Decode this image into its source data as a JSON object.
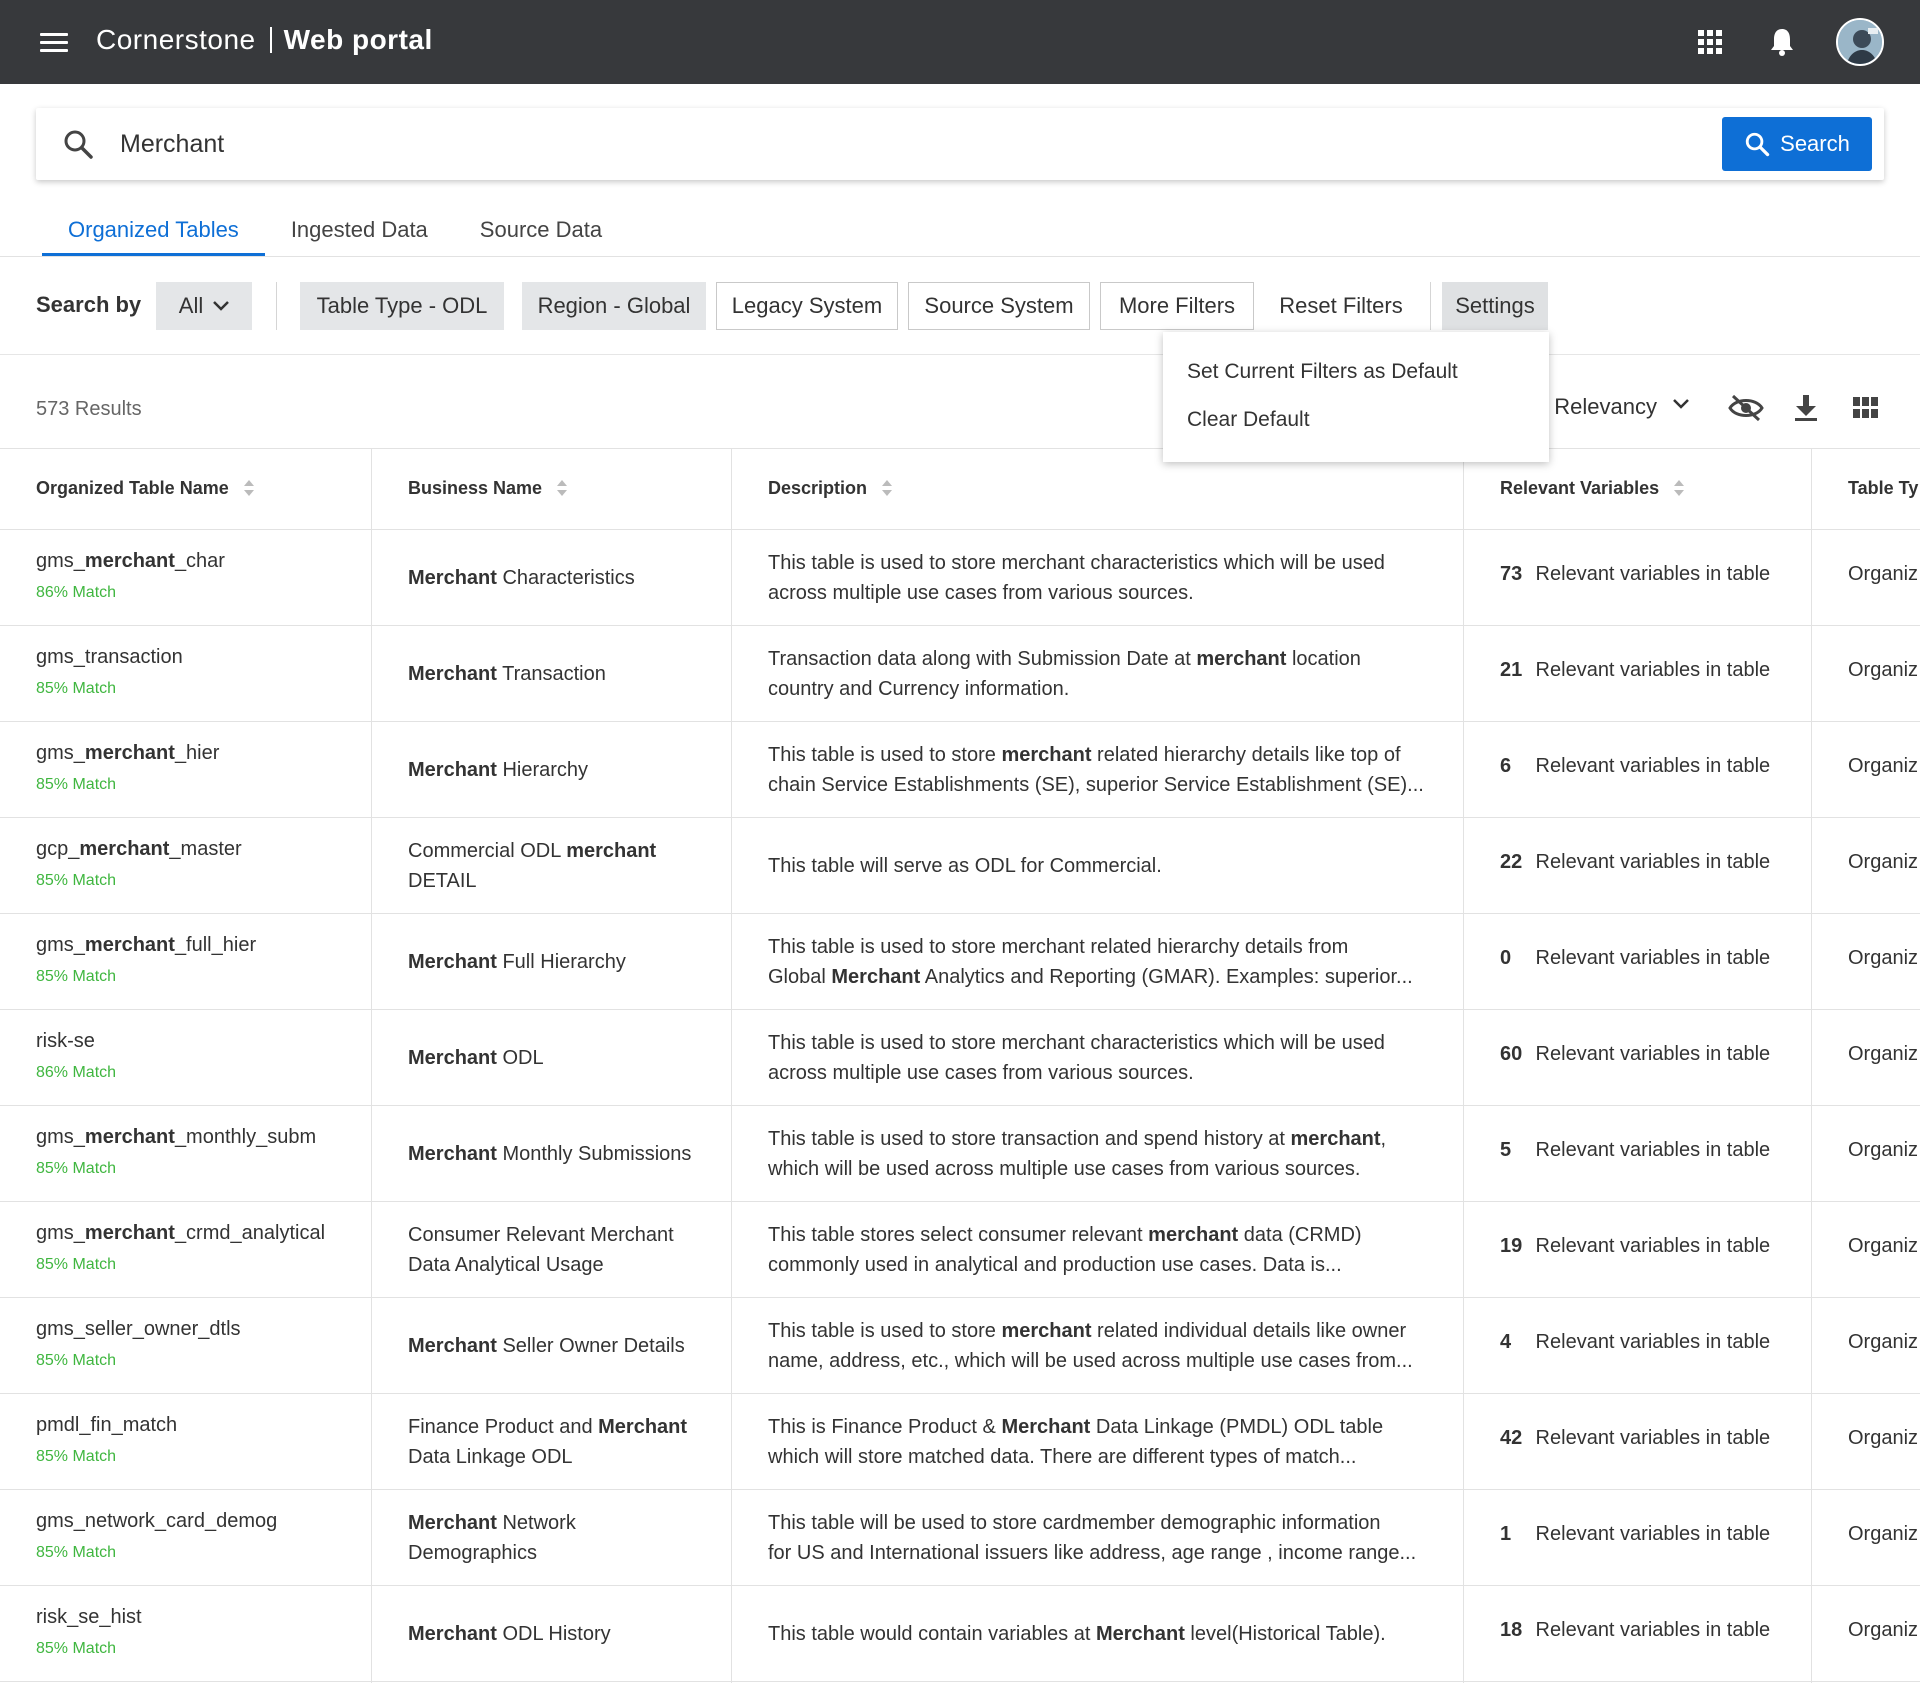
{
  "header": {
    "brand_light": "Cornerstone",
    "brand_bold": "Web portal"
  },
  "search": {
    "value": "Merchant",
    "placeholder": "",
    "button_label": "Search"
  },
  "tabs": [
    {
      "label": "Organized Tables",
      "active": true
    },
    {
      "label": "Ingested Data",
      "active": false
    },
    {
      "label": "Source Data",
      "active": false
    }
  ],
  "filters": {
    "search_by_label": "Search by",
    "all_label": "All",
    "chips": [
      "Table Type - ODL",
      "Region - Global",
      "Legacy System",
      "Source System",
      "More Filters",
      "Reset Filters",
      "Settings"
    ]
  },
  "settings_menu": {
    "items": [
      "Set Current Filters as Default",
      "Clear Default"
    ]
  },
  "results": {
    "count_label": "573 Results",
    "sort_label": ": Relevancy"
  },
  "columns": [
    "Organized Table Name",
    "Business Name",
    "Description",
    "Relevant Variables",
    "Table Ty"
  ],
  "rel_suffix": "Relevant variables in table",
  "rows": [
    {
      "name": [
        [
          "gms_",
          false
        ],
        [
          "merchant",
          true
        ],
        [
          "_char",
          false
        ]
      ],
      "match": "86% Match",
      "business": [
        [
          "Merchant",
          true
        ],
        [
          " Characteristics",
          false
        ]
      ],
      "business_lines": 1,
      "desc1": [
        [
          "This table is used to store merchant characteristics which will be used",
          false
        ]
      ],
      "desc2": [
        [
          "across multiple use cases from various sources.",
          false
        ]
      ],
      "rel": "73",
      "type": "Organiz"
    },
    {
      "name": [
        [
          "gms_transaction",
          false
        ]
      ],
      "match": "85% Match",
      "business": [
        [
          "Merchant",
          true
        ],
        [
          " Transaction",
          false
        ]
      ],
      "business_lines": 1,
      "desc1": [
        [
          "Transaction data along with Submission Date at ",
          false
        ],
        [
          "merchant",
          true
        ],
        [
          " location",
          false
        ]
      ],
      "desc2": [
        [
          "country and Currency information.",
          false
        ]
      ],
      "rel": "21",
      "type": "Organiz"
    },
    {
      "name": [
        [
          "gms_",
          false
        ],
        [
          "merchant",
          true
        ],
        [
          "_hier",
          false
        ]
      ],
      "match": "85% Match",
      "business": [
        [
          "Merchant",
          true
        ],
        [
          " Hierarchy",
          false
        ]
      ],
      "business_lines": 1,
      "desc1": [
        [
          "This table is used to store ",
          false
        ],
        [
          "merchant",
          true
        ],
        [
          " related hierarchy details like top of",
          false
        ]
      ],
      "desc2": [
        [
          "chain Service Establishments (SE), superior Service Establishment (SE)...",
          false
        ]
      ],
      "rel": "6",
      "type": "Organiz"
    },
    {
      "name": [
        [
          "gcp_",
          false
        ],
        [
          "merchant",
          true
        ],
        [
          "_master",
          false
        ]
      ],
      "match": "85% Match",
      "business": [
        [
          "Commercial ODL ",
          false
        ],
        [
          "merchant",
          true
        ]
      ],
      "business2": [
        [
          "DETAIL",
          false
        ]
      ],
      "business_lines": 2,
      "desc1": [
        [
          "This table will serve as ODL for Commercial.",
          false
        ]
      ],
      "desc2": [],
      "rel": "22",
      "type": "Organiz"
    },
    {
      "name": [
        [
          "gms_",
          false
        ],
        [
          "merchant",
          true
        ],
        [
          "_full_hier",
          false
        ]
      ],
      "match": "85% Match",
      "business": [
        [
          "Merchant",
          true
        ],
        [
          " Full Hierarchy",
          false
        ]
      ],
      "business_lines": 1,
      "desc1": [
        [
          "This table is used to store merchant related hierarchy details from",
          false
        ]
      ],
      "desc2": [
        [
          "Global ",
          false
        ],
        [
          "Merchant",
          true
        ],
        [
          " Analytics and Reporting (GMAR). Examples: superior...",
          false
        ]
      ],
      "rel": "0",
      "type": "Organiz"
    },
    {
      "name": [
        [
          "risk-se",
          false
        ]
      ],
      "match": "86% Match",
      "business": [
        [
          "Merchant",
          true
        ],
        [
          " ODL",
          false
        ]
      ],
      "business_lines": 1,
      "desc1": [
        [
          "This table is used to store merchant characteristics which will be used",
          false
        ]
      ],
      "desc2": [
        [
          "across multiple use cases from various sources.",
          false
        ]
      ],
      "rel": "60",
      "type": "Organiz"
    },
    {
      "name": [
        [
          "gms_",
          false
        ],
        [
          "merchant",
          true
        ],
        [
          "_monthly_subm",
          false
        ]
      ],
      "match": "85% Match",
      "business": [
        [
          "Merchant",
          true
        ],
        [
          " Monthly Submissions",
          false
        ]
      ],
      "business_lines": 1,
      "desc1": [
        [
          "This table is used to store transaction and spend history at ",
          false
        ],
        [
          "merchant",
          true
        ],
        [
          ",",
          false
        ]
      ],
      "desc2": [
        [
          "which will be used across multiple use cases from various sources.",
          false
        ]
      ],
      "rel": "5",
      "type": "Organiz"
    },
    {
      "name": [
        [
          "gms_",
          false
        ],
        [
          "merchant",
          true
        ],
        [
          "_crmd_analytical",
          false
        ]
      ],
      "match": "85% Match",
      "business": [
        [
          "Consumer Relevant Merchant",
          false
        ]
      ],
      "business2": [
        [
          "Data Analytical Usage",
          false
        ]
      ],
      "business_lines": 2,
      "desc1": [
        [
          "This table stores select consumer relevant ",
          false
        ],
        [
          "merchant",
          true
        ],
        [
          " data (CRMD)",
          false
        ]
      ],
      "desc2": [
        [
          "commonly used in analytical and production use cases. Data is...",
          false
        ]
      ],
      "rel": "19",
      "type": "Organiz"
    },
    {
      "name": [
        [
          "gms_seller_owner_dtls",
          false
        ]
      ],
      "match": "85% Match",
      "business": [
        [
          "Merchant",
          true
        ],
        [
          " Seller Owner Details",
          false
        ]
      ],
      "business_lines": 1,
      "desc1": [
        [
          "This table is used to store ",
          false
        ],
        [
          "merchant",
          true
        ],
        [
          " related individual details like owner",
          false
        ]
      ],
      "desc2": [
        [
          "name, address, etc.,  which will be used across multiple use cases from...",
          false
        ]
      ],
      "rel": "4",
      "type": "Organiz"
    },
    {
      "name": [
        [
          "pmdl_fin_match",
          false
        ]
      ],
      "match": "85% Match",
      "business": [
        [
          "Finance Product and ",
          false
        ],
        [
          "Merchant",
          true
        ]
      ],
      "business2": [
        [
          "Data Linkage ODL",
          false
        ]
      ],
      "business_lines": 2,
      "desc1": [
        [
          "This is Finance Product & ",
          false
        ],
        [
          "Merchant",
          true
        ],
        [
          " Data Linkage (PMDL) ODL table",
          false
        ]
      ],
      "desc2": [
        [
          "which will store matched data. There are different types of match...",
          false
        ]
      ],
      "rel": "42",
      "type": "Organiz"
    },
    {
      "name": [
        [
          "gms_network_card_demog",
          false
        ]
      ],
      "match": "85% Match",
      "business": [
        [
          "Merchant",
          true
        ],
        [
          " Network",
          false
        ]
      ],
      "business2": [
        [
          "Demographics",
          false
        ]
      ],
      "business_lines": 2,
      "desc1": [
        [
          "This table will be used to store cardmember demographic information",
          false
        ]
      ],
      "desc2": [
        [
          "for US and International issuers like address, age range , income range...",
          false
        ]
      ],
      "rel": "1",
      "type": "Organiz"
    },
    {
      "name": [
        [
          "risk_se_hist",
          false
        ]
      ],
      "match": "85% Match",
      "business": [
        [
          "Merchant",
          true
        ],
        [
          " ODL History",
          false
        ]
      ],
      "business_lines": 1,
      "desc1": [
        [
          "This table would contain variables at ",
          false
        ],
        [
          "Merchant",
          true
        ],
        [
          " level(Historical Table).",
          false
        ]
      ],
      "desc2": [],
      "rel": "18",
      "type": "Organiz"
    }
  ],
  "colors": {
    "topbar": "#37393c",
    "accent": "#0e6fd6",
    "match": "#3fb63f"
  },
  "icons": {
    "menu": "hamburger-icon",
    "apps": "apps-grid-icon",
    "bell": "bell-icon",
    "search": "search-icon",
    "hide": "eye-off-icon",
    "download": "download-icon",
    "grid": "grid-view-icon"
  }
}
